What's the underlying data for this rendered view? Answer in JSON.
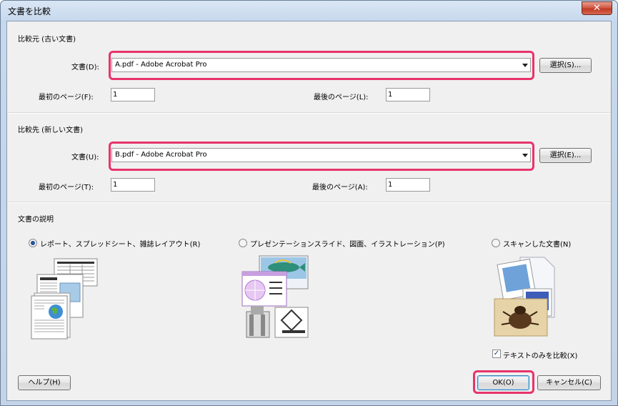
{
  "window": {
    "title": "文書を比較",
    "close_glyph": "✕"
  },
  "old_doc": {
    "group_title": "比較元 (古い文書)",
    "doc_label": "文書(D):",
    "doc_value": "A.pdf - Adobe Acrobat Pro",
    "browse_label": "選択(S)...",
    "first_page_label": "最初のページ(F):",
    "first_page_value": "1",
    "last_page_label": "最後のページ(L):",
    "last_page_value": "1"
  },
  "new_doc": {
    "group_title": "比較先 (新しい文書)",
    "doc_label": "文書(U):",
    "doc_value": "B.pdf - Adobe Acrobat Pro",
    "browse_label": "選択(E)...",
    "first_page_label": "最初のページ(T):",
    "first_page_value": "1",
    "last_page_label": "最後のページ(A):",
    "last_page_value": "1"
  },
  "description": {
    "group_title": "文書の説明",
    "options": [
      {
        "label": "レポート、スプレッドシート、雑誌レイアウト(R)",
        "selected": true
      },
      {
        "label": "プレゼンテーションスライド、図面、イラストレーション(P)",
        "selected": false
      },
      {
        "label": "スキャンした文書(N)",
        "selected": false
      }
    ],
    "text_only_label": "テキストのみを比較(X)",
    "text_only_checked": true
  },
  "buttons": {
    "help": "ヘルプ(H)",
    "ok": "OK(O)",
    "cancel": "キャンセル(C)"
  },
  "colors": {
    "highlight": "#e8336b",
    "radio_dot": "#1b3d78"
  }
}
